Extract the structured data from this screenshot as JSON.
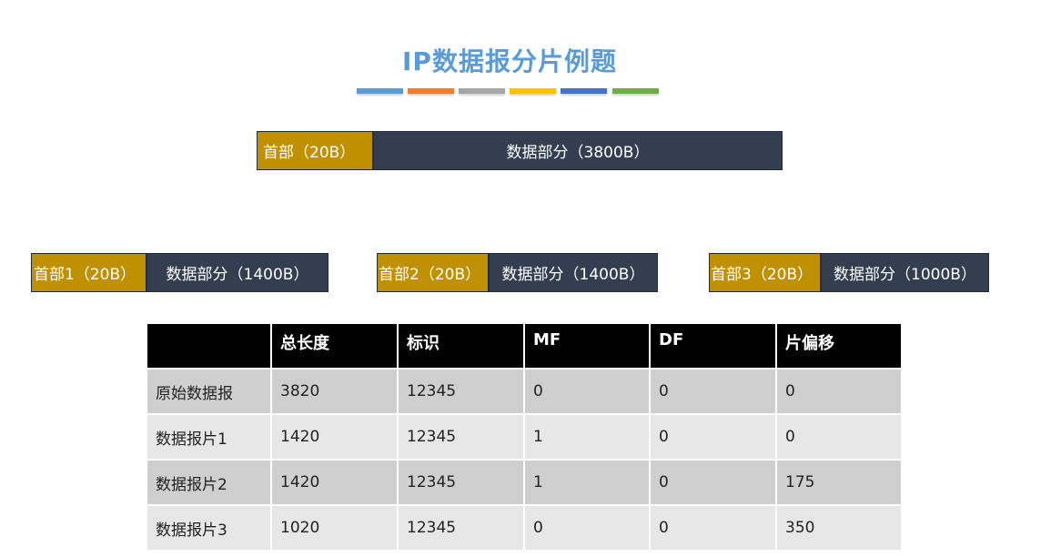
{
  "title": "IP数据报分片例题",
  "accent_colors": [
    "#5b9bd5",
    "#ed7d31",
    "#a5a5a5",
    "#ffc000",
    "#4472c4",
    "#70ad47"
  ],
  "original_packet": {
    "header": "首部（20B）",
    "data": "数据部分（3800B）"
  },
  "fragments": [
    {
      "header": "首部1（20B）",
      "data": "数据部分（1400B）"
    },
    {
      "header": "首部2（20B）",
      "data": "数据部分（1400B）"
    },
    {
      "header": "首部3（20B）",
      "data": "数据部分（1000B）"
    }
  ],
  "table": {
    "headers": [
      "",
      "总长度",
      "标识",
      "MF",
      "DF",
      "片偏移"
    ],
    "rows": [
      [
        "原始数据报",
        "3820",
        "12345",
        "0",
        "0",
        "0"
      ],
      [
        "数据报片1",
        "1420",
        "12345",
        "1",
        "0",
        "0"
      ],
      [
        "数据报片2",
        "1420",
        "12345",
        "1",
        "0",
        "175"
      ],
      [
        "数据报片3",
        "1020",
        "12345",
        "0",
        "0",
        "350"
      ]
    ]
  }
}
